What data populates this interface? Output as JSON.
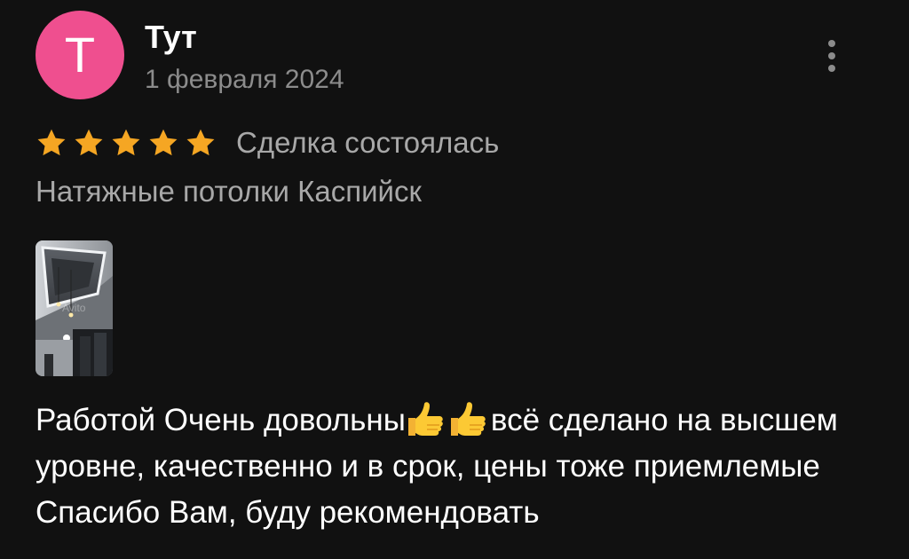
{
  "review": {
    "author": {
      "initial": "T",
      "name": "Тут",
      "avatar_color": "#ef4f8f"
    },
    "date": "1 февраля 2024",
    "more_icon": "more-vertical-icon",
    "rating": {
      "stars": 5,
      "max": 5,
      "star_color": "#f5a623"
    },
    "deal_status": "Сделка состоялась",
    "item_title": "Натяжные потолки Каспийск",
    "photos": [
      {
        "alt": "ceiling photo"
      }
    ],
    "text_part1": "Работой Очень довольны",
    "emoji": "thumbs-up-icon",
    "text_part2": "всё сделано на высшем уровне, качественно и в срок, цены тоже приемлемые Спасибо Вам, буду рекомендовать"
  }
}
